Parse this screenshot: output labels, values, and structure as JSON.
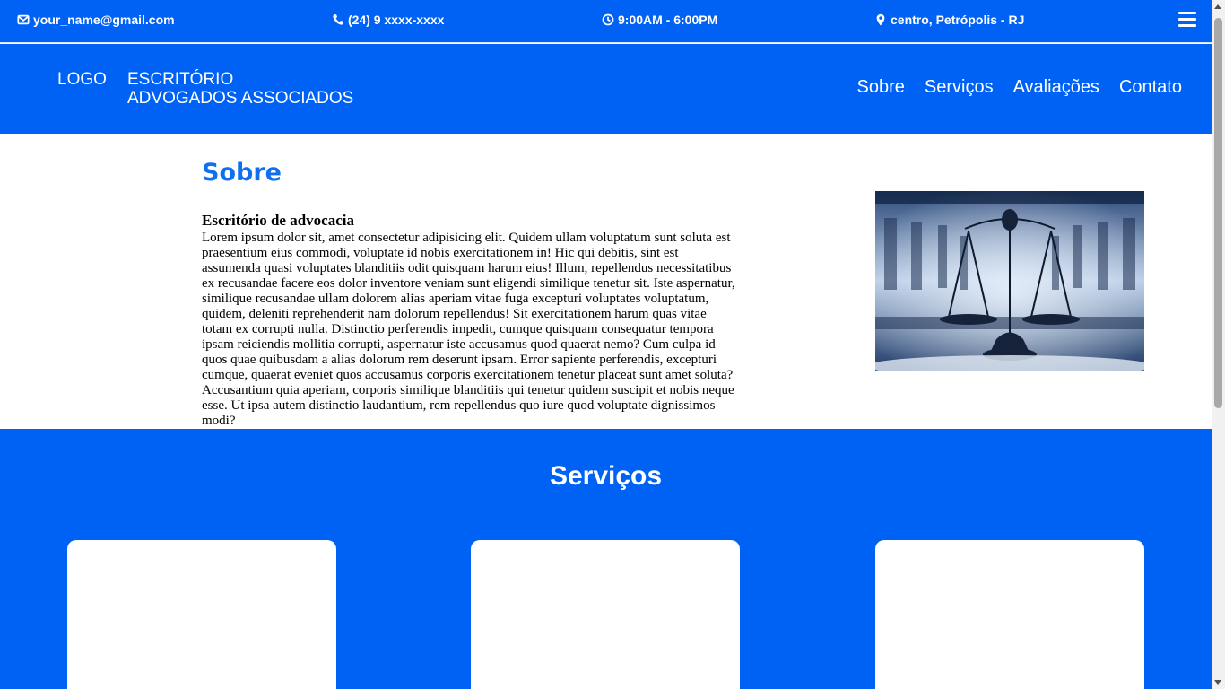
{
  "topbar": {
    "email": "your_name@gmail.com",
    "phone": "(24) 9 xxxx-xxxx",
    "hours": "9:00AM - 6:00PM",
    "location": "centro, Petrópolis - RJ"
  },
  "navbar": {
    "logo": "LOGO",
    "brand_line1": "ESCRITÓRIO",
    "brand_line2": "ADVOGADOS ASSOCIADOS",
    "links": [
      "Sobre",
      "Serviços",
      "Avaliações",
      "Contato"
    ]
  },
  "about": {
    "title": "Sobre",
    "subtitle": "Escritório de advocacia",
    "text": "Lorem ipsum dolor sit, amet consectetur adipisicing elit. Quidem ullam voluptatum sunt soluta est praesentium eius commodi, voluptate id nobis exercitationem in! Hic qui debitis, sint est assumenda quasi voluptates blanditiis odit quisquam harum eius! Illum, repellendus necessitatibus ex recusandae facere eos dolor inventore veniam sunt eligendi similique tenetur sit. Iste aspernatur, similique recusandae ullam dolorem alias aperiam vitae fuga excepturi voluptates voluptatum, quidem, deleniti reprehenderit nam dolorum repellendus! Sit exercitationem harum quas vitae totam ex corrupti nulla. Distinctio perferendis impedit, cumque quisquam consequatur tempora ipsam reiciendis mollitia corrupti, aspernatur iste accusamus quod quaerat nemo? Cum culpa id quos quae quibusdam a alias dolorum rem deserunt ipsam. Error sapiente perferendis, excepturi cumque, quaerat eveniet quos accusamus corporis exercitationem tenetur placeat sunt amet soluta? Accusantium quia aperiam, corporis similique blanditiis qui tenetur quidem suscipit et nobis neque esse. Ut ipsa autem distinctio laudantium, rem repellendus quo iure quod voluptate dignissimos modi?",
    "image_icon": "scales-of-justice-image"
  },
  "services": {
    "title": "Serviços",
    "cards": 3
  },
  "colors": {
    "primary": "#0062f5",
    "heading_accent": "#0f6ff0",
    "text": "#000000",
    "card": "#ffffff"
  },
  "icons": {
    "email": "envelope-icon",
    "phone": "phone-icon",
    "hours": "clock-icon",
    "location": "map-pin-icon",
    "menu": "hamburger-menu-icon"
  }
}
